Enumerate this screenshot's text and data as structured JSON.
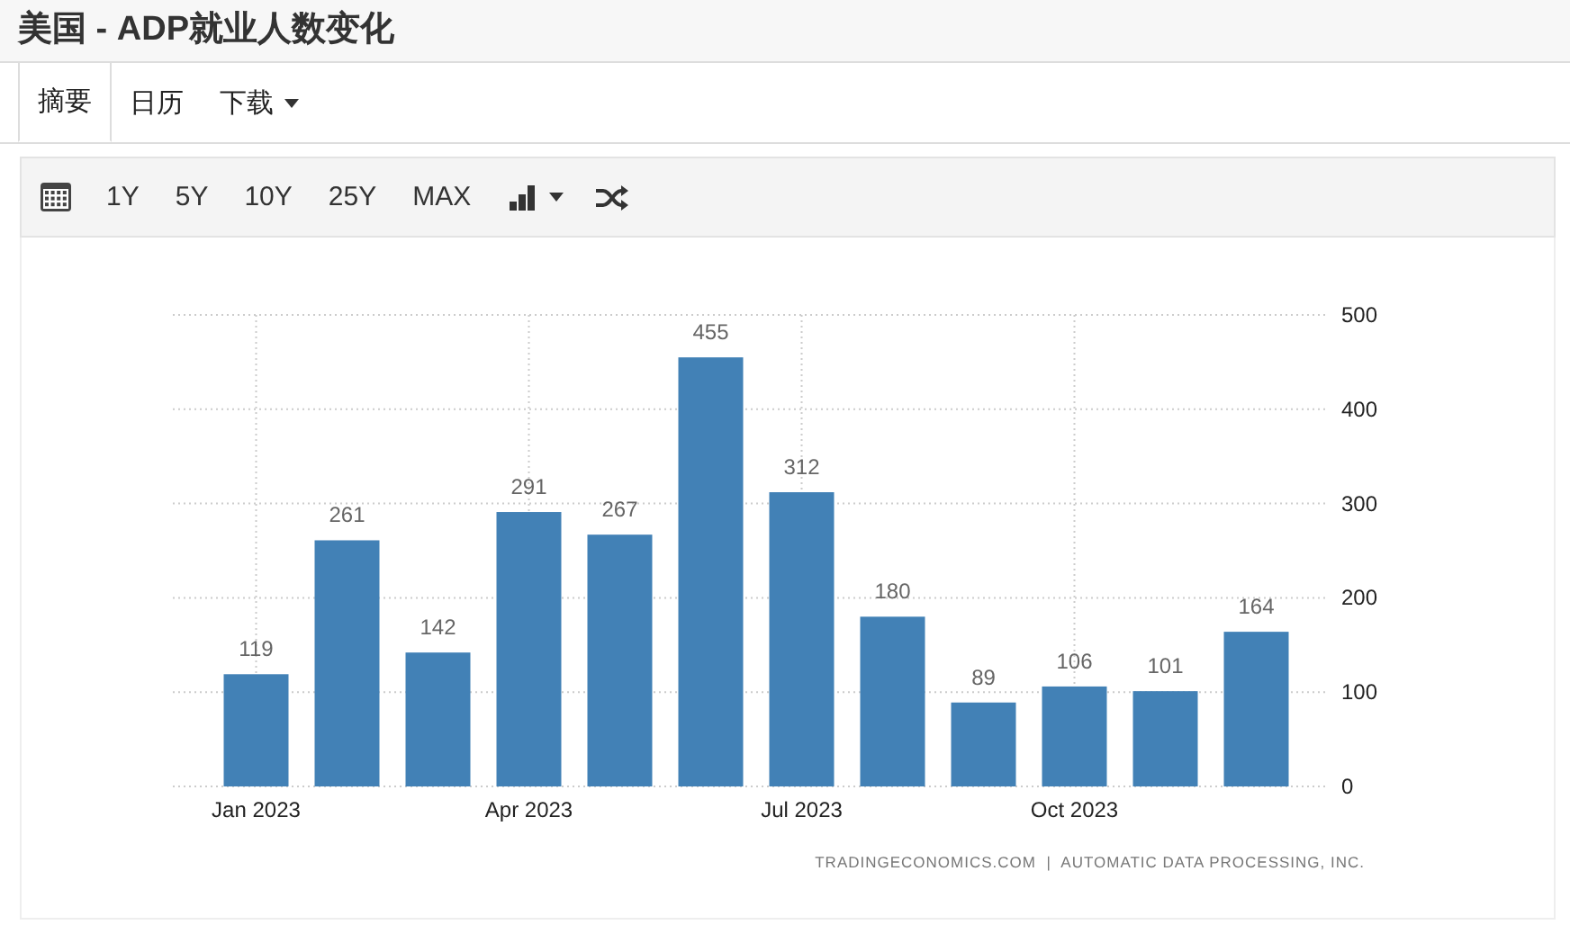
{
  "page_title": "美国 - ADP就业人数变化",
  "tabs": [
    {
      "label": "摘要",
      "selected": true
    },
    {
      "label": "日历",
      "selected": false
    },
    {
      "label": "下载",
      "selected": false,
      "dropdown": true
    }
  ],
  "toolbar": {
    "ranges": [
      "1Y",
      "5Y",
      "10Y",
      "25Y",
      "MAX"
    ]
  },
  "chart": {
    "chart_data": {
      "type": "bar",
      "categories": [
        "Jan 2023",
        null,
        null,
        "Apr 2023",
        null,
        null,
        "Jul 2023",
        null,
        null,
        "Oct 2023",
        null,
        null
      ],
      "series": [
        {
          "color": "#4281b6",
          "values": [
            119,
            261,
            142,
            291,
            267,
            455,
            312,
            180,
            89,
            106,
            101,
            164
          ]
        }
      ],
      "ylim": [
        0,
        500
      ],
      "yticks": [
        0,
        100,
        200,
        300,
        400,
        500
      ],
      "grid": true,
      "data_labels": true
    },
    "source": "TRADINGECONOMICS.COM  |  AUTOMATIC DATA PROCESSING, INC."
  }
}
